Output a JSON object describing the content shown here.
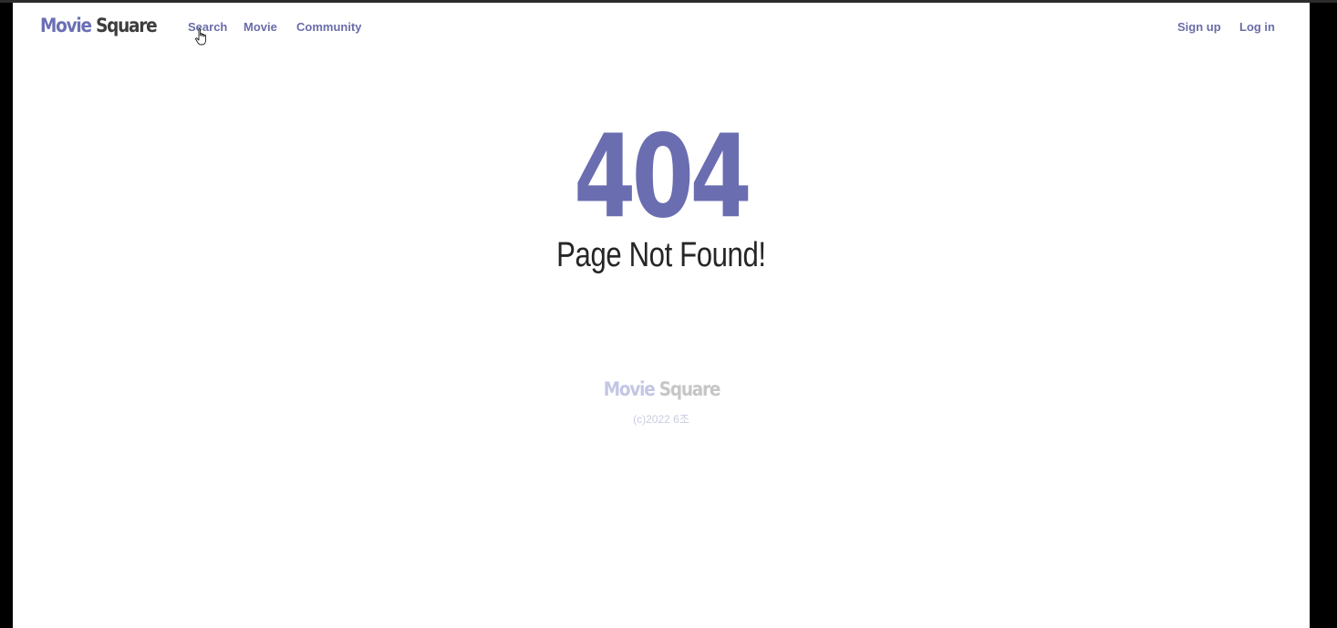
{
  "navbar": {
    "brand": {
      "part1": "Movie",
      "part2": "Square"
    },
    "links": [
      {
        "label": "Search"
      },
      {
        "label": "Movie"
      },
      {
        "label": "Community"
      }
    ],
    "auth": [
      {
        "label": "Sign up"
      },
      {
        "label": "Log in"
      }
    ]
  },
  "main": {
    "error_code": "404",
    "message": "Page Not Found!"
  },
  "footer": {
    "brand": {
      "part1": "Movie",
      "part2": "Square"
    },
    "copyright": "(c)2022 6조"
  },
  "colors": {
    "accent": "#6a6db0",
    "brand_dark": "#3d3d3d",
    "text": "#262626",
    "nav_link": "#6a6da8",
    "footer_faded": "#c3c6e4"
  },
  "icons": {
    "cursor": "hand-pointer-icon"
  }
}
